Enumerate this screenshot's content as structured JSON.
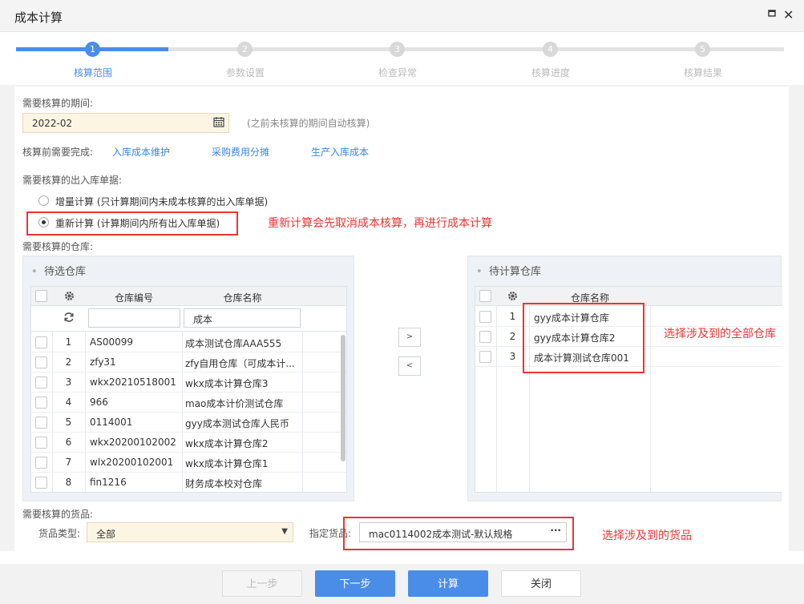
{
  "window": {
    "title": "成本计算",
    "maximize_icon": "maximize-icon",
    "close_icon": "close-icon"
  },
  "steps": [
    {
      "num": "1",
      "label": "核算范围",
      "active": true
    },
    {
      "num": "2",
      "label": "参数设置",
      "active": false
    },
    {
      "num": "3",
      "label": "检查异常",
      "active": false
    },
    {
      "num": "4",
      "label": "核算进度",
      "active": false
    },
    {
      "num": "5",
      "label": "核算结果",
      "active": false
    }
  ],
  "period": {
    "label": "需要核算的期间:",
    "value": "2022-02",
    "hint": "(之前未核算的期间自动核算)"
  },
  "prereq": {
    "label": "核算前需要完成:",
    "links": [
      "入库成本维护",
      "采购费用分摊",
      "生产入库成本"
    ]
  },
  "docs": {
    "label": "需要核算的出入库单据:",
    "options": [
      {
        "label": "增量计算 (只计算期间内未成本核算的出入库单据)",
        "checked": false
      },
      {
        "label": "重新计算 (计算期间内所有出入库单据)",
        "checked": true
      }
    ],
    "annotation": "重新计算会先取消成本核算，再进行成本计算"
  },
  "warehouse": {
    "label": "需要核算的仓库:",
    "left_title": "待选仓库",
    "right_title": "待计算仓库",
    "columns": {
      "code": "仓库编号",
      "name": "仓库名称"
    },
    "filter": {
      "code": "",
      "name": "成本"
    },
    "left_rows": [
      {
        "n": "1",
        "code": "AS00099",
        "name": "成本测试仓库AAA555"
      },
      {
        "n": "2",
        "code": "zfy31",
        "name": "zfy自用仓库（可成本计..."
      },
      {
        "n": "3",
        "code": "wkx20210518001",
        "name": "wkx成本计算仓库3"
      },
      {
        "n": "4",
        "code": "966",
        "name": "mao成本计价测试仓库"
      },
      {
        "n": "5",
        "code": "0114001",
        "name": "gyy成本测试仓库人民币"
      },
      {
        "n": "6",
        "code": "wkx20200102002",
        "name": "wkx成本计算仓库2"
      },
      {
        "n": "7",
        "code": "wlx20200102001",
        "name": "wkx成本计算仓库1"
      },
      {
        "n": "8",
        "code": "fin1216",
        "name": "财务成本校对仓库"
      }
    ],
    "right_rows": [
      {
        "n": "1",
        "name": "gyy成本计算仓库"
      },
      {
        "n": "2",
        "name": "gyy成本计算仓库2"
      },
      {
        "n": "3",
        "name": "成本计算测试仓库001"
      }
    ],
    "move_right": ">",
    "move_left": "<",
    "annotation": "选择涉及到的全部仓库"
  },
  "goods": {
    "label": "需要核算的货品:",
    "type_label": "货品类型:",
    "type_value": "全部",
    "spec_label": "指定货品:",
    "spec_value": "mac0114002成本测试-默认规格",
    "annotation": "选择涉及到的货品"
  },
  "footer": {
    "prev": "上一步",
    "next": "下一步",
    "calc": "计算",
    "close": "关闭"
  },
  "colors": {
    "accent": "#4a8de8",
    "annotation": "#e33333",
    "input_bg": "#fdf5e4"
  }
}
